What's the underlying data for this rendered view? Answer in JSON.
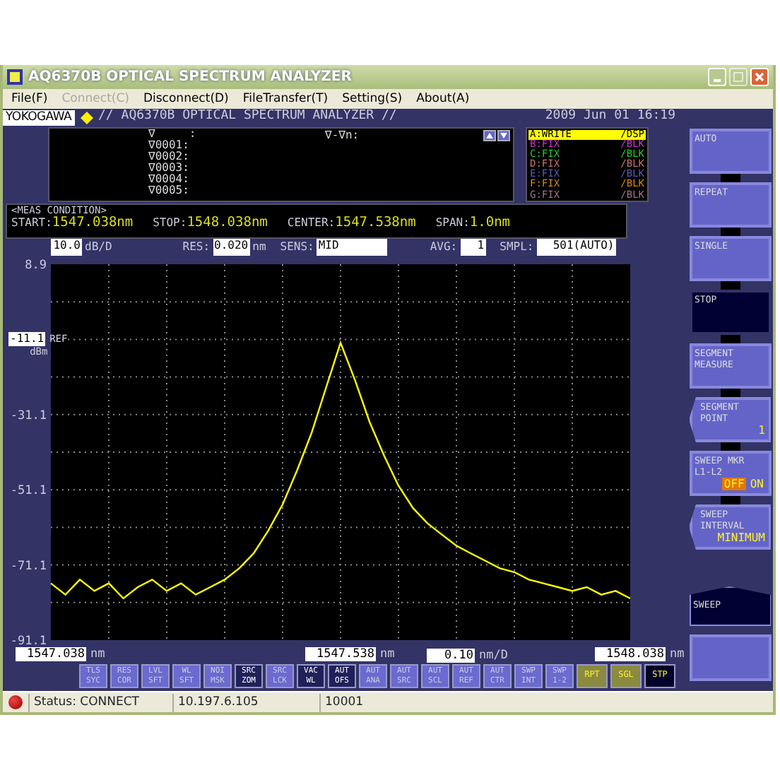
{
  "window": {
    "title": "AQ6370B OPTICAL SPECTRUM ANALYZER"
  },
  "menu": [
    {
      "label": "File(F)",
      "disabled": false
    },
    {
      "label": "Connect(C)",
      "disabled": true
    },
    {
      "label": "Disconnect(D)",
      "disabled": false
    },
    {
      "label": "FileTransfer(T)",
      "disabled": false
    },
    {
      "label": "Setting(S)",
      "disabled": false
    },
    {
      "label": "About(A)",
      "disabled": false
    }
  ],
  "header": {
    "brand": "YOKOGAWA",
    "title": "// AQ6370B OPTICAL SPECTRUM ANALYZER //",
    "datetime": "2009 Jun 01 16:19"
  },
  "markers": {
    "rows": [
      "∇     :",
      "∇0001:",
      "∇0002:",
      "∇0003:",
      "∇0004:",
      "∇0005:"
    ],
    "delta_label": "∇-∇n:"
  },
  "traces": [
    {
      "label": "A:WRITE",
      "mode": "/DSP",
      "color": "#ffff00",
      "selected": true
    },
    {
      "label": "B:FIX",
      "mode": "/BLK",
      "color": "#cc33cc",
      "selected": false
    },
    {
      "label": "C:FIX",
      "mode": "/BLK",
      "color": "#22cc22",
      "selected": false
    },
    {
      "label": "D:FIX",
      "mode": "/BLK",
      "color": "#c87070",
      "selected": false
    },
    {
      "label": "E:FIX",
      "mode": "/BLK",
      "color": "#5a5ab0",
      "selected": false
    },
    {
      "label": "F:FIX",
      "mode": "/BLK",
      "color": "#d08a00",
      "selected": false
    },
    {
      "label": "G:FIX",
      "mode": "/BLK",
      "color": "#a07088",
      "selected": false
    }
  ],
  "meas_condition": {
    "title": "<MEAS CONDITION>",
    "items": [
      {
        "label": "START:",
        "value": "1547.038nm"
      },
      {
        "label": "STOP:",
        "value": "1548.038nm"
      },
      {
        "label": "CENTER:",
        "value": "1547.538nm"
      },
      {
        "label": "SPAN:",
        "value": "1.0nm"
      }
    ]
  },
  "settings": [
    {
      "value": "10.0",
      "unit": "dB/D"
    },
    {
      "label": "RES:",
      "value": "0.020",
      "unit": "nm"
    },
    {
      "label": "SENS:",
      "value": "MID"
    },
    {
      "label": "AVG:",
      "value": "1"
    },
    {
      "label": "SMPL:",
      "value": "501(AUTO)"
    }
  ],
  "graph": {
    "ref_level": "-11.1",
    "ref_label": "REF",
    "ref_unit": "dBm",
    "x_axis": {
      "units": [
        "nm",
        "nm",
        "nm"
      ],
      "scale": "0.10",
      "scale_unit": "nm/D"
    },
    "chart_data": {
      "type": "line",
      "x": [
        1547.038,
        1547.063,
        1547.088,
        1547.113,
        1547.138,
        1547.163,
        1547.188,
        1547.213,
        1547.238,
        1547.263,
        1547.288,
        1547.313,
        1547.338,
        1547.363,
        1547.388,
        1547.413,
        1547.438,
        1547.463,
        1547.488,
        1547.513,
        1547.538,
        1547.563,
        1547.588,
        1547.613,
        1547.638,
        1547.663,
        1547.688,
        1547.713,
        1547.738,
        1547.763,
        1547.788,
        1547.813,
        1547.838,
        1547.863,
        1547.888,
        1547.913,
        1547.938,
        1547.963,
        1547.988,
        1548.013,
        1548.038
      ],
      "series": [
        {
          "color": "#ffff00",
          "values": [
            -76,
            -79,
            -75,
            -78,
            -76,
            -80,
            -77,
            -75,
            -78,
            -76,
            -79,
            -77,
            -75,
            -72,
            -68,
            -62,
            -55,
            -46,
            -36,
            -24,
            -12,
            -22,
            -33,
            -42,
            -50,
            -56,
            -60,
            -63,
            -66,
            -68,
            -70,
            -72,
            -73,
            -75,
            -76,
            -77,
            -78,
            -77,
            -79,
            -78,
            -80
          ]
        }
      ],
      "grid": true,
      "xlim": [
        1547.038,
        1548.038
      ],
      "ylim": [
        -91.1,
        8.9
      ],
      "xticks": [
        {
          "value": 1547.038,
          "label": "1547.038"
        },
        {
          "value": 1547.538,
          "label": "1547.538"
        },
        {
          "value": 1548.038,
          "label": "1548.038"
        }
      ],
      "yticks": [
        {
          "value": 8.9,
          "label": "8.9"
        },
        {
          "value": -31.1,
          "label": "-31.1"
        },
        {
          "value": -51.1,
          "label": "-51.1"
        },
        {
          "value": -71.1,
          "label": "-71.1"
        },
        {
          "value": -91.1,
          "label": "-91.1"
        }
      ]
    }
  },
  "function_keys": [
    {
      "label": "TLS SYC",
      "kind": "func",
      "on": false
    },
    {
      "label": "RES COR",
      "kind": "func",
      "on": false
    },
    {
      "label": "LVL SFT",
      "kind": "func",
      "on": false
    },
    {
      "label": "WL SFT",
      "kind": "func",
      "on": false
    },
    {
      "label": "NOI MSK",
      "kind": "func",
      "on": false
    },
    {
      "label": "SRC ZOM",
      "kind": "func",
      "on": true
    },
    {
      "label": "SRC LCK",
      "kind": "func",
      "on": false
    },
    {
      "label": "VAC WL",
      "kind": "func",
      "on": true
    },
    {
      "label": "AUT OFS",
      "kind": "func",
      "on": true
    },
    {
      "label": "AUT ANA",
      "kind": "func",
      "on": false
    },
    {
      "label": "AUT SRC",
      "kind": "func",
      "on": false
    },
    {
      "label": "AUT SCL",
      "kind": "func",
      "on": false
    },
    {
      "label": "AUT REF",
      "kind": "func",
      "on": false
    },
    {
      "label": "AUT CTR",
      "kind": "func",
      "on": false
    },
    {
      "label": "SWP INT",
      "kind": "func",
      "on": false
    },
    {
      "label": "SWP 1-2",
      "kind": "func",
      "on": false
    },
    {
      "label": "RPT",
      "kind": "sweep",
      "on": false
    },
    {
      "label": "SGL",
      "kind": "sweep",
      "on": false
    },
    {
      "label": "STP",
      "kind": "sweep",
      "on": true
    }
  ],
  "softkeys": [
    {
      "label": "AUTO",
      "kind": "plain",
      "selected": false
    },
    {
      "label": "REPEAT",
      "kind": "plain",
      "selected": false
    },
    {
      "label": "SINGLE",
      "kind": "plain",
      "selected": false
    },
    {
      "label": "STOP",
      "kind": "plain",
      "selected": true
    },
    {
      "label": "SEGMENT MEASURE",
      "kind": "plain",
      "selected": false
    },
    {
      "label": "SEGMENT POINT",
      "kind": "value",
      "value": "1",
      "selected": false
    },
    {
      "label": "SWEEP MKR L1-L2",
      "kind": "toggle",
      "options": [
        {
          "label": "OFF",
          "selected": true
        },
        {
          "label": "ON",
          "selected": false
        }
      ],
      "selected": false
    },
    {
      "label": "SWEEP INTERVAL",
      "kind": "value",
      "value": "MINIMUM",
      "selected": false
    }
  ],
  "menu_tab": {
    "label": "SWEEP"
  },
  "status_bar": {
    "connected": true,
    "status": "Status: CONNECT",
    "address": "10.197.6.105",
    "port": "10001"
  }
}
